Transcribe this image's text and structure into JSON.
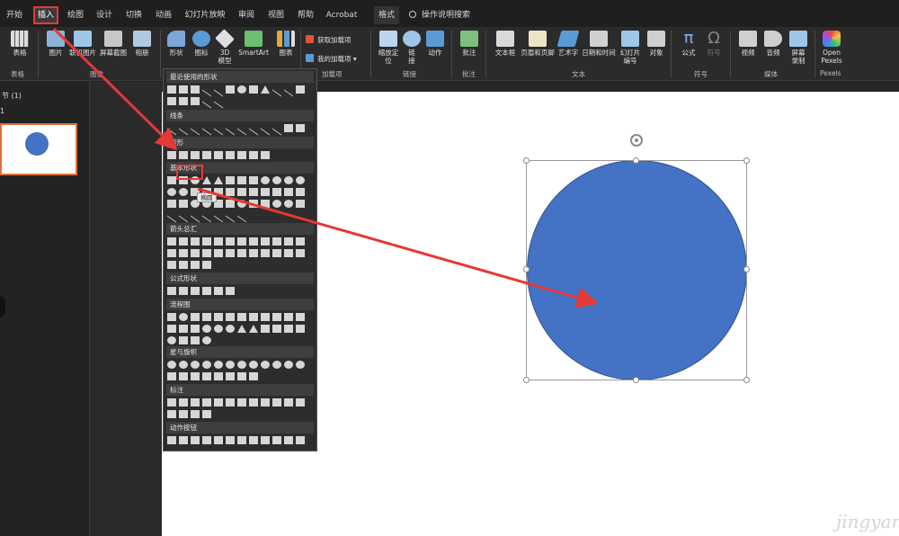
{
  "tabs": [
    "开始",
    "插入",
    "绘图",
    "设计",
    "切换",
    "动画",
    "幻灯片放映",
    "审阅",
    "视图",
    "帮助",
    "Acrobat",
    "格式"
  ],
  "active_tab": "插入",
  "search_label": "操作说明搜索",
  "ribbon": {
    "buttons": {
      "table": "表格",
      "picture": "图片",
      "online_picture": "联机图片",
      "screenshot": "屏幕截图",
      "album": "相册",
      "shapes": "形状",
      "icons": "图标",
      "model3d_line1": "3D",
      "model3d_line2": "模型",
      "smartart": "SmartArt",
      "chart": "图表",
      "get_addins": "获取加载项",
      "my_addins": "我的加载项",
      "zoom_line1": "缩放定",
      "zoom_line2": "位",
      "link_line1": "链",
      "link_line2": "接",
      "action": "动作",
      "comment": "批注",
      "textbox": "文本框",
      "header_footer": "页眉和页脚",
      "wordart": "艺术字",
      "datetime": "日期和时间",
      "slide_no_line1": "幻灯片",
      "slide_no_line2": "编号",
      "object": "对象",
      "equation": "公式",
      "symbol": "符号",
      "video": "视频",
      "audio": "音频",
      "screenrec_line1": "屏幕",
      "screenrec_line2": "录制",
      "pexels_line1": "Open",
      "pexels_line2": "Pexels"
    },
    "groups": {
      "tables": "表格",
      "images": "图像",
      "addins": "加载项",
      "links": "链接",
      "comments": "批注",
      "text": "文本",
      "symbols": "符号",
      "media": "媒体",
      "pexels": "Pexels"
    }
  },
  "slides_pane": {
    "section_label": "节 (1)",
    "slide_number": "1"
  },
  "shapes_menu": {
    "sections": [
      "最近使用的形状",
      "线条",
      "矩形",
      "基本形状",
      "箭头总汇",
      "公式形状",
      "流程图",
      "星与旗帜",
      "标注",
      "动作按钮"
    ],
    "tooltip": "椭圆"
  },
  "watermark": "jingyan",
  "colors": {
    "shape_fill": "#4472c4",
    "highlight_red": "#e53935",
    "ribbon_bg": "#2b2b2b"
  }
}
